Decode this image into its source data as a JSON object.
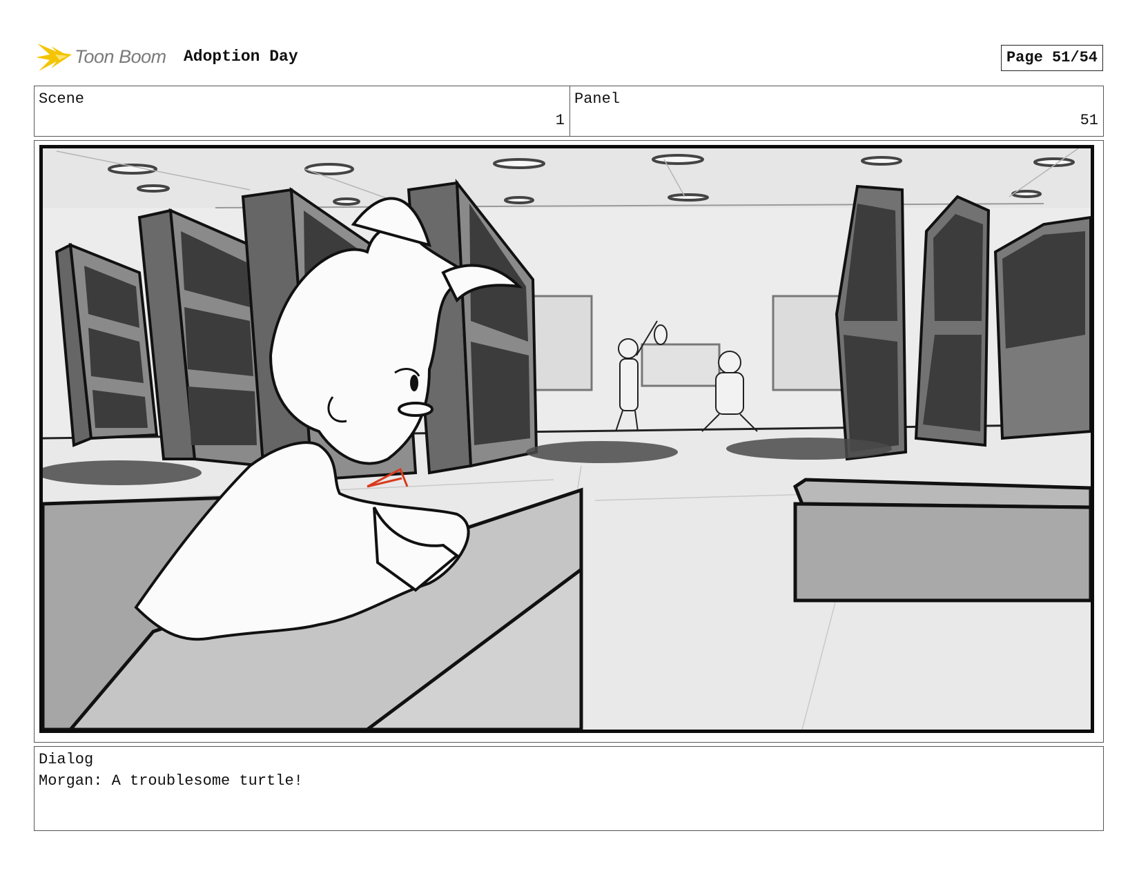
{
  "header": {
    "logo_text": "Toon Boom",
    "project_title": "Adoption Day",
    "page_label": "Page 51/54"
  },
  "info": {
    "scene_label": "Scene",
    "scene_value": "1",
    "panel_label": "Panel",
    "panel_value": "51"
  },
  "dialog": {
    "label": "Dialog",
    "text": "Morgan: A troublesome turtle!"
  },
  "colors": {
    "logo_accent": "#f5c400",
    "logo_text": "#7a7a7a",
    "frame_border": "#0d0d0d",
    "sketch_accent": "#d83a1c"
  }
}
